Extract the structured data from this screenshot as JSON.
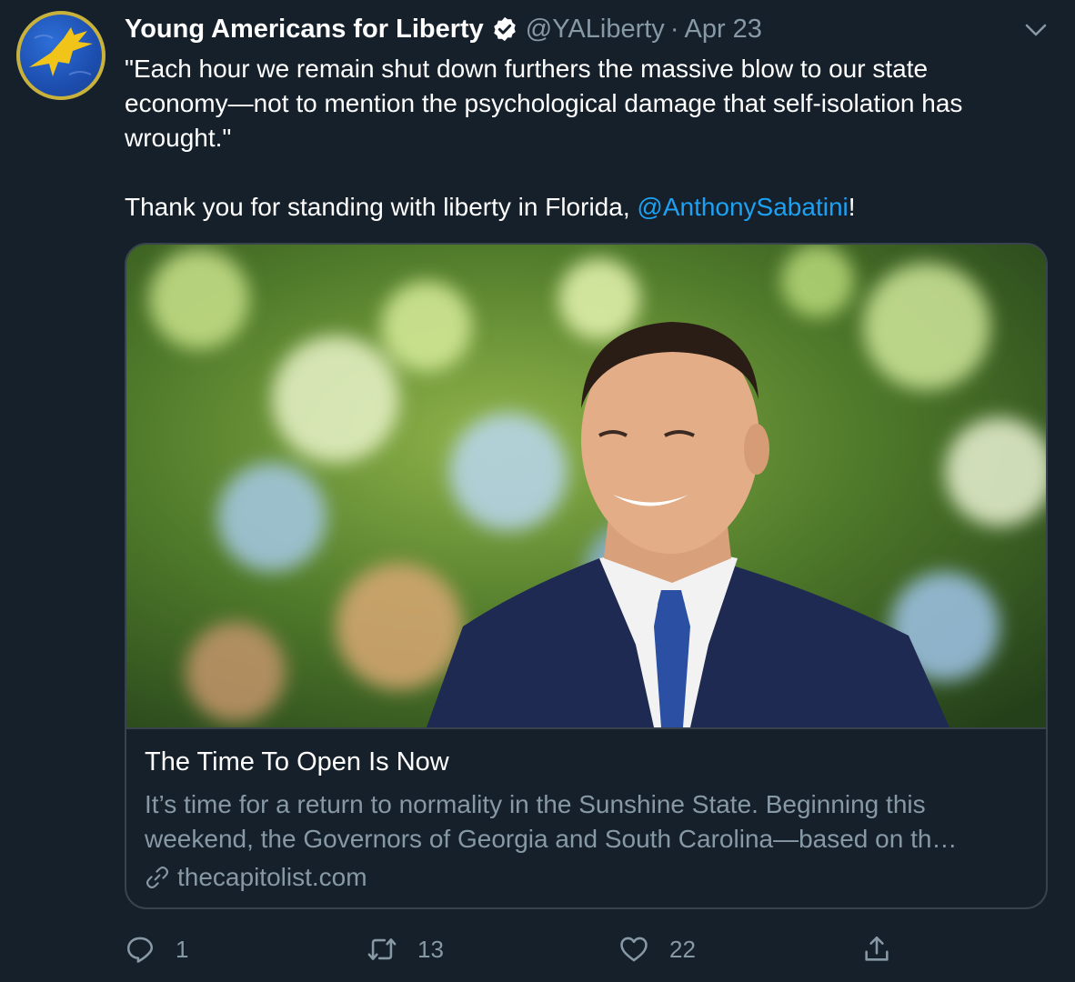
{
  "tweet": {
    "author": {
      "display_name": "Young Americans for Liberty",
      "handle": "@YALiberty",
      "verified": true,
      "avatar": "eagle-logo-icon"
    },
    "separator": "·",
    "date": "Apr 23",
    "text": {
      "line1": "\"Each hour we remain shut down furthers the massive blow to our state economy—not to mention the psychological damage that self-isolation has wrought.\"",
      "line2_prefix": "Thank you for standing with liberty in Florida, ",
      "mention": "@AnthonySabatini",
      "line2_suffix": "!"
    },
    "card": {
      "title": "The Time To Open Is Now",
      "description": "It’s time for a return to normality in the Sunshine State. Beginning this weekend, the Governors of Georgia and South Carolina—based on th…",
      "domain": "thecapitolist.com"
    },
    "actions": {
      "reply_count": "1",
      "retweet_count": "13",
      "like_count": "22"
    }
  },
  "colors": {
    "background": "#15202b",
    "secondary_text": "#8899a6",
    "link": "#1da1f2",
    "border": "#38444d"
  },
  "icons": [
    "verified-badge-icon",
    "chevron-down-icon",
    "link-icon",
    "reply-icon",
    "retweet-icon",
    "like-icon",
    "share-icon"
  ]
}
